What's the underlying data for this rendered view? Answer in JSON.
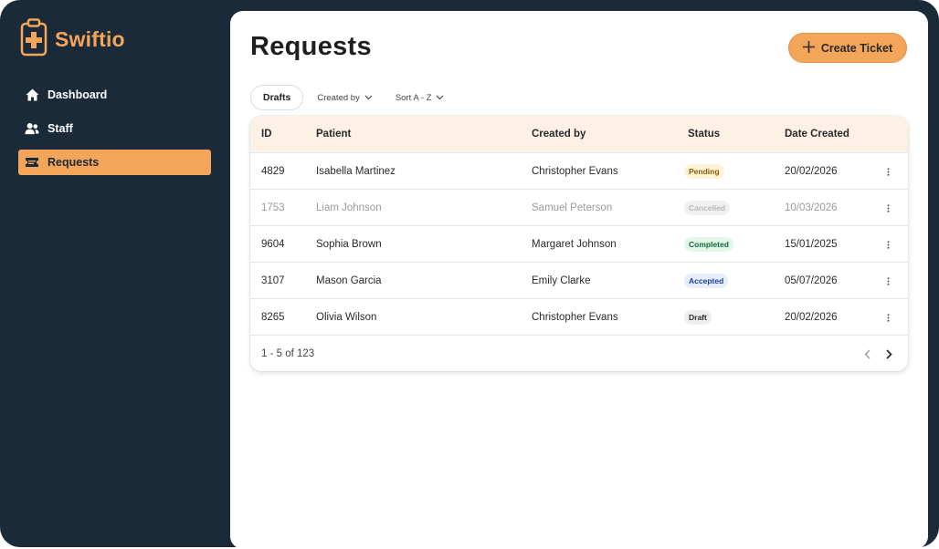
{
  "app": {
    "name": "Swiftio",
    "brand_color": "#f3a55a",
    "sidebar_bg": "#1b2a38"
  },
  "sidebar": {
    "items": [
      {
        "label": "Dashboard",
        "icon": "home-icon",
        "active": false
      },
      {
        "label": "Staff",
        "icon": "users-icon",
        "active": false
      },
      {
        "label": "Requests",
        "icon": "ticket-icon",
        "active": true
      }
    ]
  },
  "header": {
    "title": "Requests",
    "create_button": "Create Ticket"
  },
  "filters": {
    "drafts": "Drafts",
    "created_by": "Created by",
    "sort": "Sort A - Z"
  },
  "table": {
    "columns": {
      "id": "ID",
      "patient": "Patient",
      "created_by": "Created by",
      "status": "Status",
      "date": "Date Created"
    },
    "rows": [
      {
        "id": "4829",
        "patient": "Isabella Martinez",
        "created_by": "Christopher Evans",
        "status": "Pending",
        "status_color": "#8a5a00",
        "status_bg": "#fdf3d6",
        "date": "20/02/2026",
        "muted": false
      },
      {
        "id": "1753",
        "patient": "Liam Johnson",
        "created_by": "Samuel Peterson",
        "status": "Cancelled",
        "status_color": "#b8b8b8",
        "status_bg": "#f0f0f0",
        "date": "10/03/2026",
        "muted": true
      },
      {
        "id": "9604",
        "patient": "Sophia Brown",
        "created_by": "Margaret Johnson",
        "status": "Completed",
        "status_color": "#0e6b3a",
        "status_bg": "#e2f6e9",
        "date": "15/01/2025",
        "muted": false
      },
      {
        "id": "3107",
        "patient": "Mason Garcia",
        "created_by": "Emily Clarke",
        "status": "Accepted",
        "status_color": "#1f3f9e",
        "status_bg": "#e6edfb",
        "date": "05/07/2026",
        "muted": false
      },
      {
        "id": "8265",
        "patient": "Olivia Wilson",
        "created_by": "Christopher Evans",
        "status": "Draft",
        "status_color": "#2a2a2a",
        "status_bg": "#eeeeee",
        "date": "20/02/2026",
        "muted": false
      }
    ]
  },
  "pagination": {
    "info": "1 - 5 of 123"
  }
}
